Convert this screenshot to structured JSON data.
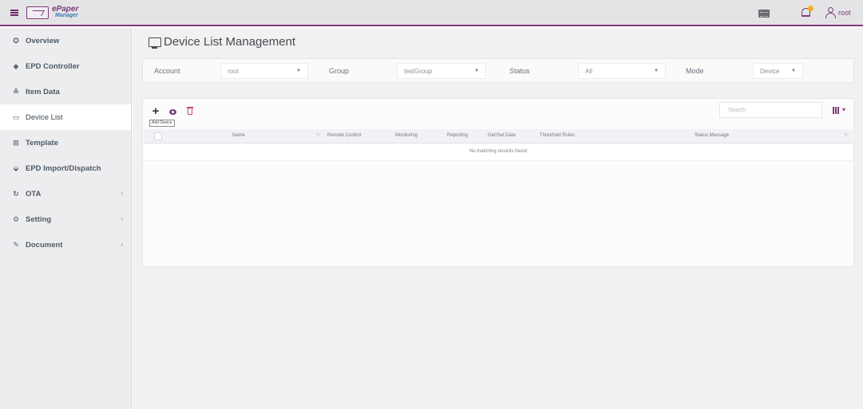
{
  "app": {
    "logo_text_top": "ePaper",
    "logo_text_bottom": "Manager",
    "user_name": "root",
    "accent_color": "#7b3b78",
    "notification_color": "#f3b323"
  },
  "sidebar": {
    "items": [
      {
        "label": "Overview",
        "icon": "dashboard-icon"
      },
      {
        "label": "EPD Controller",
        "icon": "tag-icon"
      },
      {
        "label": "Item Data",
        "icon": "database-icon"
      },
      {
        "label": "Device List",
        "icon": "monitor-icon"
      },
      {
        "label": "Template",
        "icon": "template-icon"
      },
      {
        "label": "EPD Import/Dispatch",
        "icon": "import-icon"
      },
      {
        "label": "OTA",
        "icon": "refresh-icon"
      },
      {
        "label": "Setting",
        "icon": "gear-icon"
      },
      {
        "label": "Document",
        "icon": "document-icon"
      }
    ],
    "active": "Device List"
  },
  "page": {
    "title": "Device List Management"
  },
  "filters": {
    "account_label": "Account",
    "account_value": "root",
    "group_label": "Group",
    "group_value": "testGroup",
    "status_label": "Status",
    "status_value": "All",
    "mode_label": "Mode",
    "mode_value": "Device"
  },
  "toolbar": {
    "add_tooltip": "Add Device",
    "search_placeholder": "Search"
  },
  "table": {
    "columns": [
      "Name",
      "Remote Control",
      "Monitoring",
      "Reporting",
      "Get/Set Data",
      "Threshold Rules",
      "Status Message"
    ],
    "empty_message": "No matching records found"
  }
}
